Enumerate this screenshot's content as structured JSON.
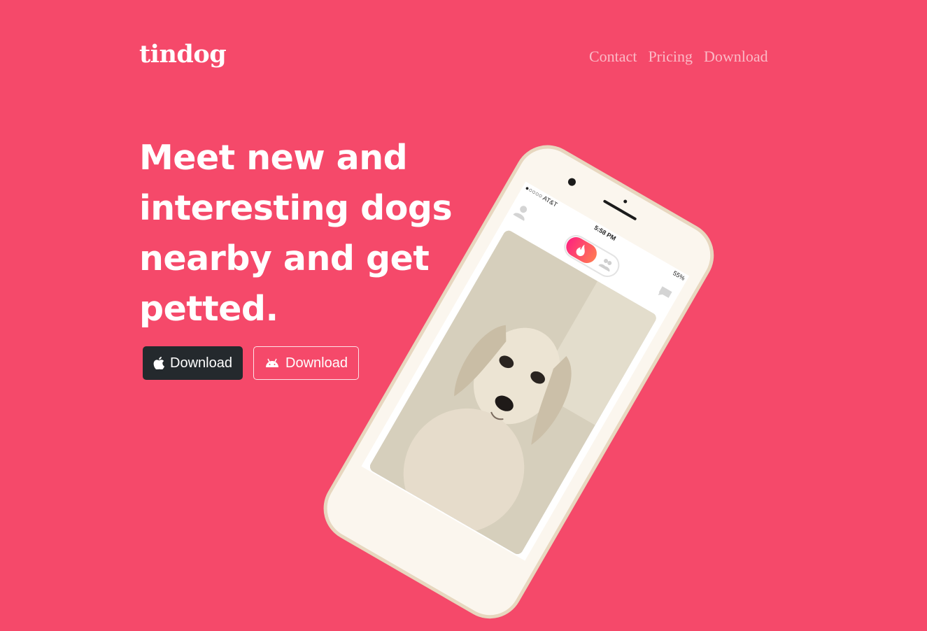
{
  "brand": {
    "name": "tindog"
  },
  "nav": {
    "links": [
      {
        "label": "Contact"
      },
      {
        "label": "Pricing"
      },
      {
        "label": "Download"
      }
    ]
  },
  "hero": {
    "headline": "Meet new and interesting dogs nearby and get petted.",
    "buttons": {
      "apple": {
        "label": "Download",
        "icon": "apple-icon"
      },
      "android": {
        "label": "Download",
        "icon": "android-icon"
      }
    }
  },
  "phone": {
    "status": {
      "carrier": "●○○○○ AT&T",
      "time": "5:58 PM",
      "battery": "55%"
    }
  },
  "colors": {
    "background": "#f5496a",
    "apple_button": "#24292d",
    "text": "#ffffff"
  }
}
